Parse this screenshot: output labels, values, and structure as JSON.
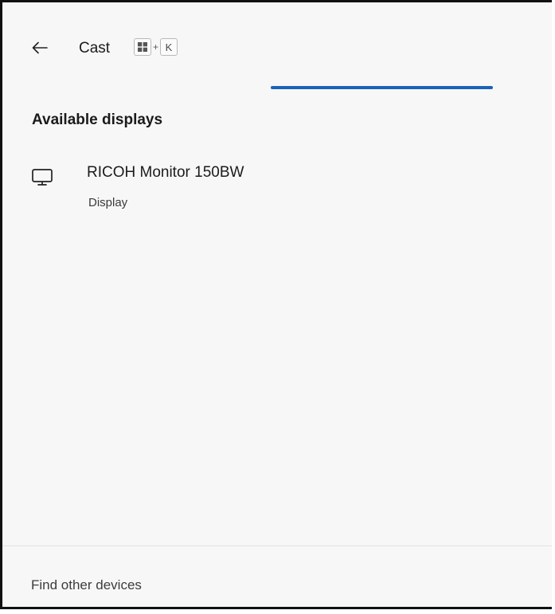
{
  "header": {
    "back_icon": "arrow-left-icon",
    "title": "Cast",
    "shortcut": {
      "key1_icon": "windows-key-icon",
      "plus": "+",
      "key2": "K"
    }
  },
  "progress": {
    "indeterminate": true,
    "color": "#1a63b8"
  },
  "section": {
    "title": "Available displays"
  },
  "devices": [
    {
      "icon": "monitor-icon",
      "name": "RICOH Monitor 150BW",
      "type": "Display"
    }
  ],
  "footer": {
    "link": "Find other devices"
  },
  "colors": {
    "panel_bg": "#f7f7f7",
    "accent": "#1a63b8",
    "text": "#1b1b1b"
  }
}
